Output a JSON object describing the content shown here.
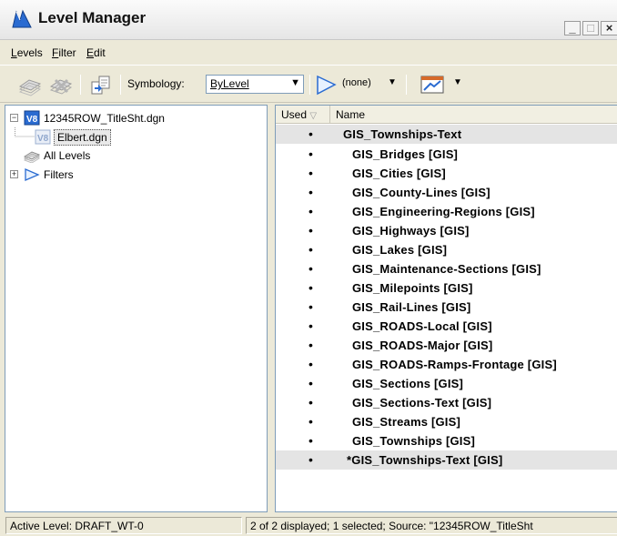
{
  "window": {
    "title": "Level Manager",
    "controls": {
      "minimize": "_",
      "maximize": "□",
      "close": "×"
    }
  },
  "menu": [
    {
      "mnemonic": "L",
      "rest": "evels"
    },
    {
      "mnemonic": "F",
      "rest": "ilter"
    },
    {
      "mnemonic": "E",
      "rest": "dit"
    }
  ],
  "toolbar": {
    "symbology_label": "Symbology:",
    "symbology_value": "ByLevel",
    "filter_value": "(none)",
    "dropdown_arrow": "▼"
  },
  "tree": {
    "root": "12345ROW_TitleSht.dgn",
    "child": "Elbert.dgn",
    "all_levels": "All Levels",
    "filters": "Filters"
  },
  "list": {
    "columns": {
      "used": "Used",
      "sort_indicator": "▽",
      "name": "Name"
    },
    "header_row": {
      "used": "•",
      "name": "GIS_Townships-Text"
    },
    "rows": [
      {
        "used": "•",
        "name": "GIS_Bridges [GIS]"
      },
      {
        "used": "•",
        "name": "GIS_Cities [GIS]"
      },
      {
        "used": "•",
        "name": "GIS_County-Lines [GIS]"
      },
      {
        "used": "•",
        "name": "GIS_Engineering-Regions [GIS]"
      },
      {
        "used": "•",
        "name": "GIS_Highways [GIS]"
      },
      {
        "used": "•",
        "name": "GIS_Lakes [GIS]"
      },
      {
        "used": "•",
        "name": "GIS_Maintenance-Sections [GIS]"
      },
      {
        "used": "•",
        "name": "GIS_Milepoints [GIS]"
      },
      {
        "used": "•",
        "name": "GIS_Rail-Lines [GIS]"
      },
      {
        "used": "•",
        "name": "GIS_ROADS-Local [GIS]"
      },
      {
        "used": "•",
        "name": "GIS_ROADS-Major [GIS]"
      },
      {
        "used": "•",
        "name": "GIS_ROADS-Ramps-Frontage [GIS]"
      },
      {
        "used": "•",
        "name": "GIS_Sections [GIS]"
      },
      {
        "used": "•",
        "name": "GIS_Sections-Text [GIS]"
      },
      {
        "used": "•",
        "name": "GIS_Streams [GIS]"
      },
      {
        "used": "•",
        "name": "GIS_Townships [GIS]"
      },
      {
        "used": "•",
        "name": "*GIS_Townships-Text [GIS]"
      }
    ]
  },
  "status": {
    "active_level": "Active Level: DRAFT_WT-0",
    "summary": "2 of 2 displayed; 1 selected; Source: \"12345ROW_TitleSht"
  },
  "colors": {
    "accent": "#2a6bd1",
    "list_highlight": "#e4e4e4"
  }
}
